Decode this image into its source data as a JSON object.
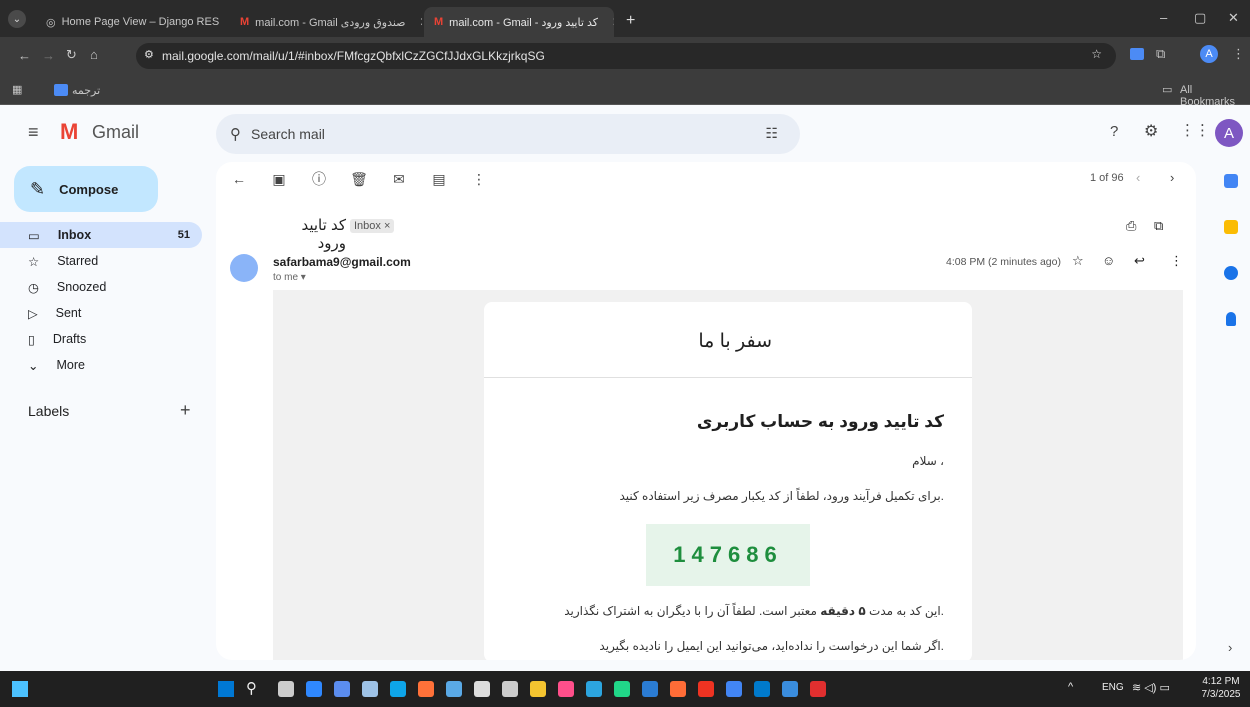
{
  "browser": {
    "tabs": [
      {
        "label": "Home Page View – Django RES",
        "active": false
      },
      {
        "label": "mail.com - Gmail صندوق ورودی",
        "active": false
      },
      {
        "label": "mail.com - Gmail - کد تایید ورود",
        "active": true
      }
    ],
    "url": "mail.google.com/mail/u/1/#inbox/FMfcgzQbfxlCzZGCfJJdxGLKkzjrkqSG",
    "bookmark_translate": "ترجمه",
    "all_bookmarks": "All Bookmarks",
    "profile_initial": "A"
  },
  "gmail": {
    "logo_text": "Gmail",
    "search_placeholder": "Search mail",
    "avatar_initial": "A",
    "compose": "Compose",
    "nav": [
      {
        "label": "Inbox",
        "count": "51",
        "icon": "inbox-icon",
        "selected": true
      },
      {
        "label": "Starred",
        "count": "",
        "icon": "star-icon",
        "selected": false
      },
      {
        "label": "Snoozed",
        "count": "",
        "icon": "clock-icon",
        "selected": false
      },
      {
        "label": "Sent",
        "count": "",
        "icon": "send-icon",
        "selected": false
      },
      {
        "label": "Drafts",
        "count": "",
        "icon": "draft-icon",
        "selected": false
      },
      {
        "label": "More",
        "count": "",
        "icon": "chevron-down-icon",
        "selected": false
      }
    ],
    "labels_heading": "Labels",
    "pagination": "1 of 96",
    "subject": "کد تایید ورود",
    "inbox_chip": "Inbox ×",
    "sender": "safarbama9@gmail.com",
    "to_me": "to me",
    "time": "4:08 PM (2 minutes ago)",
    "email": {
      "brand": "سفر با ما",
      "heading": "کد تایید ورود به حساب کاربری",
      "greeting": "، سلام",
      "instruction": ".برای تکمیل فرآیند ورود، لطفاً از کد یکبار مصرف زیر استفاده کنید",
      "code": "147686",
      "validity_prefix": ".این کد به مدت ",
      "validity_bold": "۵ دقیقه",
      "validity_suffix": " معتبر است. لطفاً آن را با دیگران به اشتراک نگذارید",
      "ignore": ".اگر شما این درخواست را نداده‌اید، می‌توانید این ایمیل را نادیده بگیرید"
    }
  },
  "taskbar": {
    "lang": "ENG",
    "time": "4:12 PM",
    "date": "7/3/2025"
  },
  "colors": {
    "compose": "#c2e7ff",
    "selected_nav": "#d3e3fd",
    "code_bg": "#e6f4ea",
    "code_text": "#1e8e3e",
    "gmail_red": "#ea4335"
  }
}
